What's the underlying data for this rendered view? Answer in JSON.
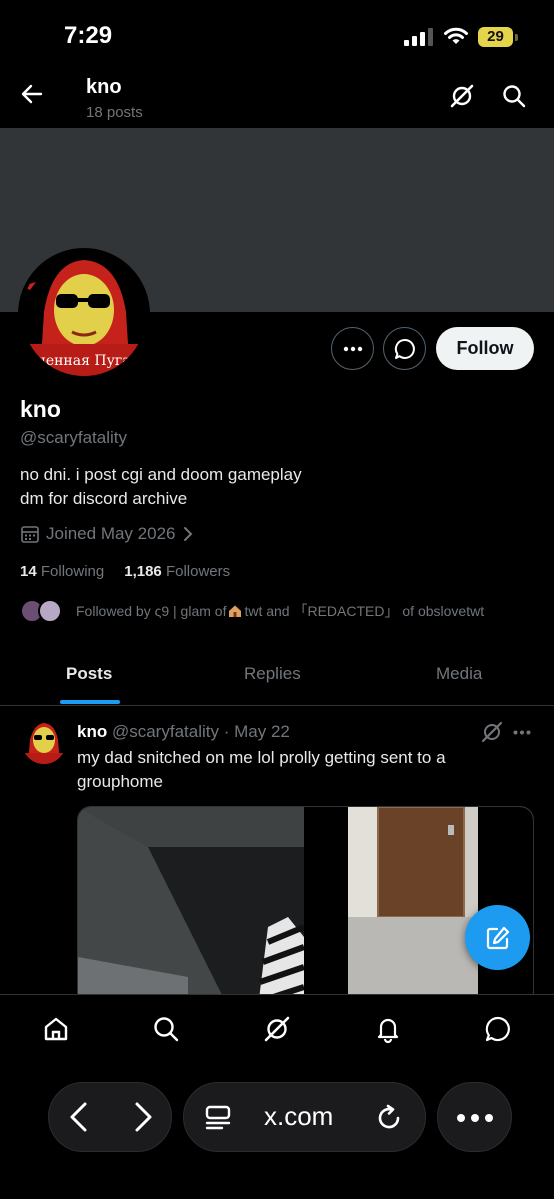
{
  "status_bar": {
    "time": "7:29",
    "battery": "29"
  },
  "header": {
    "title": "kno",
    "post_count": "18 posts"
  },
  "profile": {
    "display_name": "kno",
    "handle": "@scaryfatality",
    "bio_line1": "no dni. i post cgi and doom gameplay",
    "bio_line2": "dm for discord archive",
    "joined": "Joined May 2026",
    "following_count": "14",
    "following_label": "Following",
    "followers_count": "1,186",
    "followers_label": "Followers",
    "followed_by_prefix": "Followed by ς9 | glam of",
    "followed_by_suffix": "twt and 「REDACTED」 of obslovetwt",
    "follow_label": "Follow",
    "avatar_text": "ененная Пугач"
  },
  "tabs": [
    {
      "label": "Posts",
      "active": true
    },
    {
      "label": "Replies",
      "active": false
    },
    {
      "label": "Media",
      "active": false
    }
  ],
  "post": {
    "name": "kno",
    "handle": "@scaryfatality",
    "separator": "·",
    "date": "May 22",
    "text": "my dad snitched on me lol prolly getting sent to a grouphome"
  },
  "browser": {
    "url": "x.com"
  },
  "colors": {
    "accent": "#1d9bf0",
    "banner": "#323538",
    "muted": "#71767b"
  },
  "icons": {
    "header": [
      "back-arrow-icon",
      "grok-icon",
      "search-icon"
    ],
    "nav": [
      "home-icon",
      "search-icon",
      "grok-icon",
      "bell-icon",
      "messages-icon"
    ],
    "browser": [
      "back-icon",
      "forward-icon",
      "tabs-icon",
      "reload-icon",
      "more-icon"
    ]
  }
}
